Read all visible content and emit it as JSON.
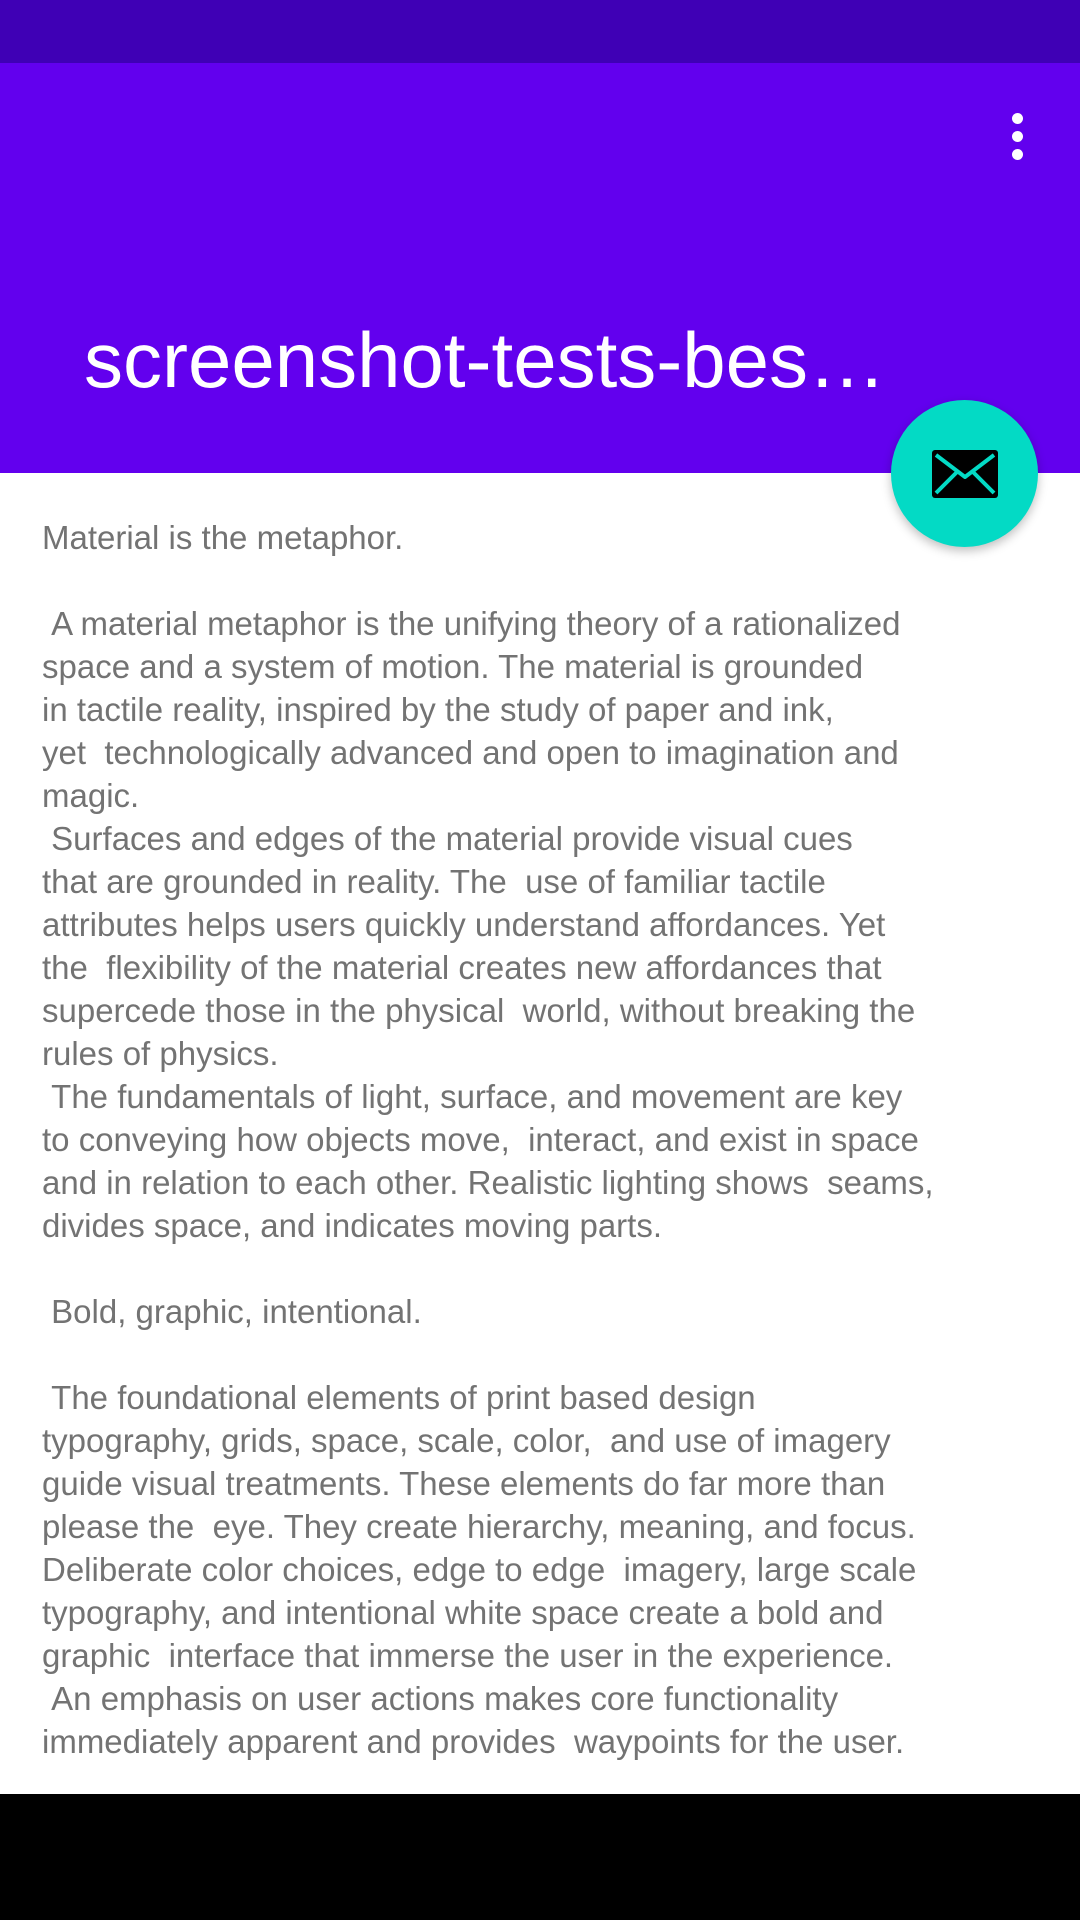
{
  "app_bar": {
    "title": "screenshot-tests-bes…",
    "menu_icon": "more-vert-icon",
    "color": "#6200ee",
    "status_bar_color": "#3f00b5"
  },
  "fab": {
    "icon": "email-icon",
    "color": "#03dac5"
  },
  "content": {
    "text": "Material is the metaphor.\n\n A material metaphor is the unifying theory of a rationalized\nspace and a system of motion. The material is grounded\nin tactile reality, inspired by the study of paper and ink,\nyet  technologically advanced and open to imagination and\nmagic.\n Surfaces and edges of the material provide visual cues\nthat are grounded in reality. The  use of familiar tactile\nattributes helps users quickly understand affordances. Yet\nthe  flexibility of the material creates new affordances that\nsupercede those in the physical  world, without breaking the\nrules of physics.\n The fundamentals of light, surface, and movement are key\nto conveying how objects move,  interact, and exist in space\nand in relation to each other. Realistic lighting shows  seams,\ndivides space, and indicates moving parts.\n\n Bold, graphic, intentional.\n\n The foundational elements of print based design\ntypography, grids, space, scale, color,  and use of imagery\nguide visual treatments. These elements do far more than\nplease the  eye. They create hierarchy, meaning, and focus.\nDeliberate color choices, edge to edge  imagery, large scale\ntypography, and intentional white space create a bold and\ngraphic  interface that immerse the user in the experience.\n An emphasis on user actions makes core functionality\nimmediately apparent and provides  waypoints for the user."
  }
}
